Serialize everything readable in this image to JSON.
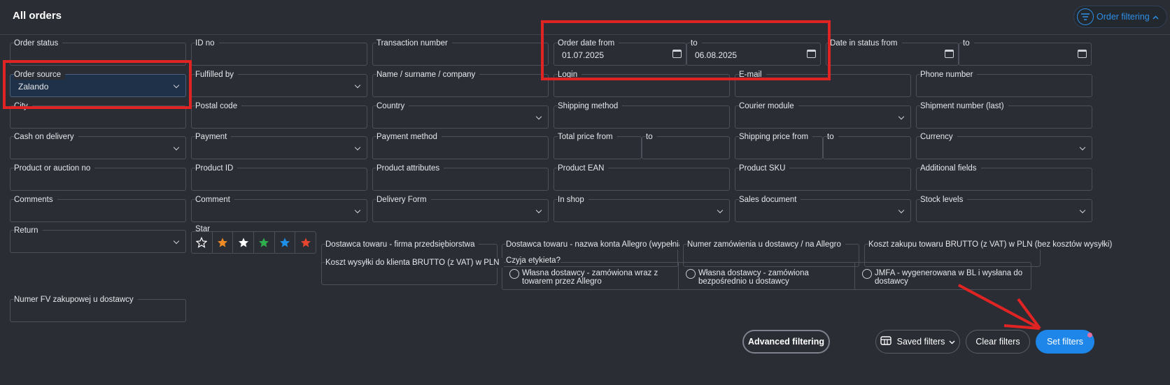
{
  "header": {
    "title": "All orders",
    "filter_toggle_label": "Order filtering"
  },
  "fields": {
    "order_status": "Order status",
    "id_no": "ID no",
    "transaction_number": "Transaction number",
    "order_date_from": "Order date from",
    "order_date_from_value": "01.07.2025",
    "order_date_to": "to",
    "order_date_to_value": "06.08.2025",
    "date_in_status_from": "Date in status from",
    "date_in_status_to": "to",
    "order_source": "Order source",
    "order_source_value": "Zalando",
    "fulfilled_by": "Fulfilled by",
    "name_surname_company": "Name / surname / company",
    "login": "Login",
    "email": "E-mail",
    "phone_number": "Phone number",
    "city": "City",
    "postal_code": "Postal code",
    "country": "Country",
    "shipping_method": "Shipping method",
    "courier_module": "Courier module",
    "shipment_number": "Shipment number (last)",
    "cash_on_delivery": "Cash on delivery",
    "payment": "Payment",
    "payment_method": "Payment method",
    "total_price_from": "Total price from",
    "total_price_to": "to",
    "shipping_price_from": "Shipping price from",
    "shipping_price_to": "to",
    "currency": "Currency",
    "product_or_auction_no": "Product or auction no",
    "product_id": "Product ID",
    "product_attributes": "Product attributes",
    "product_ean": "Product EAN",
    "product_sku": "Product SKU",
    "additional_fields": "Additional fields",
    "comments": "Comments",
    "comment": "Comment",
    "delivery_form": "Delivery Form",
    "in_shop": "In shop",
    "sales_document": "Sales document",
    "stock_levels": "Stock levels",
    "return": "Return",
    "star": "Star",
    "dostawca_firma": "Dostawca towaru - firma przedsiębiorstwa",
    "dostawca_konta": "Dostawca towaru - nazwa konta Allegro (wypełniamy t",
    "numer_zamowienia": "Numer zamówienia u dostawcy / na Allegro",
    "koszt_zakupu": "Koszt zakupu towaru BRUTTO (z VAT) w PLN (bez kosztów wysyłki)",
    "koszt_wysylki": "Koszt wysyłki do klienta BRUTTO (z VAT) w PLN",
    "czyja_etykieta": "Czyja etykieta?",
    "numer_fv": "Numer FV zakupowej u dostawcy"
  },
  "radio_options": [
    "Własna dostawcy - zamówiona wraz z towarem przez Allegro",
    "Własna dostawcy - zamówiona bezpośrednio u dostawcy",
    "JMFA - wygenerowana w BL i wysłana do dostawcy"
  ],
  "star_colors": [
    "#ffffff",
    "#f08a24",
    "#ffffff",
    "#2fae4e",
    "#1e90e8",
    "#e8452f"
  ],
  "buttons": {
    "advanced_filtering": "Advanced filtering",
    "saved_filters": "Saved filters",
    "clear_filters": "Clear filters",
    "set_filters": "Set filters"
  },
  "colors": {
    "accent": "#1d86e8",
    "annotation": "#e02424"
  }
}
